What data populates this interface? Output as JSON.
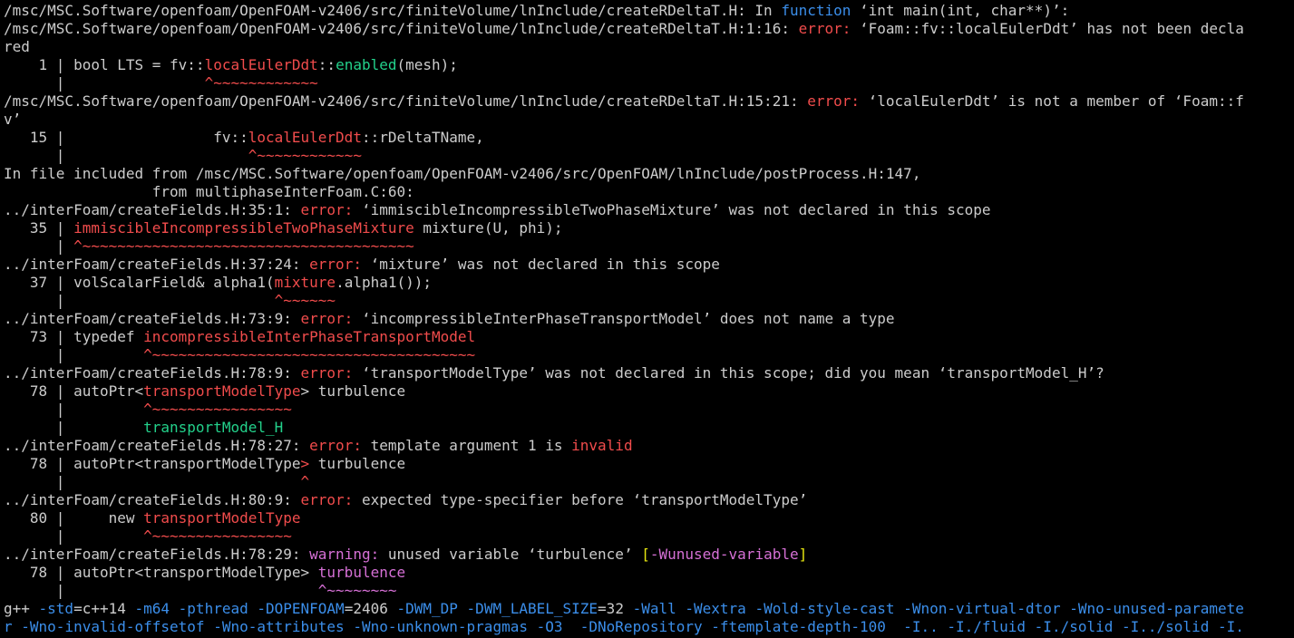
{
  "window": {
    "kind": "terminal",
    "width": 1427,
    "height": 704
  },
  "colors": {
    "background": "#000000",
    "default_text": "#cccccc",
    "error_label": "#f14c4c",
    "code_highlight": "#f14c4c",
    "keyword": "#3b8eea",
    "fixit_green": "#23d18b",
    "warning_label": "#d670d6",
    "warning_flag": "#e5e510",
    "compile_flag": "#3b8eea"
  },
  "lines": [
    {
      "segments": [
        {
          "text": "/msc/MSC.Software/openfoam/OpenFOAM-v2406/src/finiteVolume/lnInclude/createRDeltaT.H: In "
        },
        {
          "text": "function",
          "color": "#3b8eea"
        },
        {
          "text": " ‘int main(int, char**)’:"
        }
      ]
    },
    {
      "segments": [
        {
          "text": "/msc/MSC.Software/openfoam/OpenFOAM-v2406/src/finiteVolume/lnInclude/createRDeltaT.H:1:16: "
        },
        {
          "text": "error:",
          "color": "#f14c4c"
        },
        {
          "text": " ‘Foam::fv::localEulerDdt’ has not been decla"
        }
      ]
    },
    {
      "segments": [
        {
          "text": "red"
        }
      ]
    },
    {
      "segments": [
        {
          "text": "    1 | bool LTS = fv::"
        },
        {
          "text": "localEulerDdt",
          "color": "#f14c4c"
        },
        {
          "text": "::"
        },
        {
          "text": "enabled",
          "color": "#23d18b"
        },
        {
          "text": "(mesh);"
        }
      ]
    },
    {
      "segments": [
        {
          "text": "      |                ",
          "color": "#cccccc"
        },
        {
          "text": "^~~~~~~~~~~~~",
          "color": "#f14c4c"
        }
      ]
    },
    {
      "segments": [
        {
          "text": "/msc/MSC.Software/openfoam/OpenFOAM-v2406/src/finiteVolume/lnInclude/createRDeltaT.H:15:21: "
        },
        {
          "text": "error:",
          "color": "#f14c4c"
        },
        {
          "text": " ‘localEulerDdt’ is not a member of ‘Foam::f"
        }
      ]
    },
    {
      "segments": [
        {
          "text": "v’"
        }
      ]
    },
    {
      "segments": [
        {
          "text": "   15 |                 fv::"
        },
        {
          "text": "localEulerDdt",
          "color": "#f14c4c"
        },
        {
          "text": "::rDeltaTName,"
        }
      ]
    },
    {
      "segments": [
        {
          "text": "      |                     "
        },
        {
          "text": "^~~~~~~~~~~~~",
          "color": "#f14c4c"
        }
      ]
    },
    {
      "segments": [
        {
          "text": "In file included from /msc/MSC.Software/openfoam/OpenFOAM-v2406/src/OpenFOAM/lnInclude/postProcess.H:147,"
        }
      ]
    },
    {
      "segments": [
        {
          "text": "                 from multiphaseInterFoam.C:60:"
        }
      ]
    },
    {
      "segments": [
        {
          "text": "../interFoam/createFields.H:35:1: "
        },
        {
          "text": "error:",
          "color": "#f14c4c"
        },
        {
          "text": " ‘immiscibleIncompressibleTwoPhaseMixture’ was not declared in this scope"
        }
      ]
    },
    {
      "segments": [
        {
          "text": "   35 | "
        },
        {
          "text": "immiscibleIncompressibleTwoPhaseMixture",
          "color": "#f14c4c"
        },
        {
          "text": " mixture(U, phi);"
        }
      ]
    },
    {
      "segments": [
        {
          "text": "      | "
        },
        {
          "text": "^~~~~~~~~~~~~~~~~~~~~~~~~~~~~~~~~~~~~~~",
          "color": "#f14c4c"
        }
      ]
    },
    {
      "segments": [
        {
          "text": "../interFoam/createFields.H:37:24: "
        },
        {
          "text": "error:",
          "color": "#f14c4c"
        },
        {
          "text": " ‘mixture’ was not declared in this scope"
        }
      ]
    },
    {
      "segments": [
        {
          "text": "   37 | volScalarField& alpha1("
        },
        {
          "text": "mixture",
          "color": "#f14c4c"
        },
        {
          "text": ".alpha1());"
        }
      ]
    },
    {
      "segments": [
        {
          "text": "      |                        "
        },
        {
          "text": "^~~~~~~",
          "color": "#f14c4c"
        }
      ]
    },
    {
      "segments": [
        {
          "text": "../interFoam/createFields.H:73:9: "
        },
        {
          "text": "error:",
          "color": "#f14c4c"
        },
        {
          "text": " ‘incompressibleInterPhaseTransportModel’ does not name a type"
        }
      ]
    },
    {
      "segments": [
        {
          "text": "   73 | typedef "
        },
        {
          "text": "incompressibleInterPhaseTransportModel",
          "color": "#f14c4c"
        }
      ]
    },
    {
      "segments": [
        {
          "text": "      |         "
        },
        {
          "text": "^~~~~~~~~~~~~~~~~~~~~~~~~~~~~~~~~~~~~~",
          "color": "#f14c4c"
        }
      ]
    },
    {
      "segments": [
        {
          "text": "../interFoam/createFields.H:78:9: "
        },
        {
          "text": "error:",
          "color": "#f14c4c"
        },
        {
          "text": " ‘transportModelType’ was not declared in this scope; did you mean ‘transportModel_H’?"
        }
      ]
    },
    {
      "segments": [
        {
          "text": "   78 | autoPtr<"
        },
        {
          "text": "transportModelType",
          "color": "#f14c4c"
        },
        {
          "text": "> turbulence"
        }
      ]
    },
    {
      "segments": [
        {
          "text": "      |         "
        },
        {
          "text": "^~~~~~~~~~~~~~~~~",
          "color": "#f14c4c"
        }
      ]
    },
    {
      "segments": [
        {
          "text": "      |         "
        },
        {
          "text": "transportModel_H",
          "color": "#23d18b"
        }
      ]
    },
    {
      "segments": [
        {
          "text": "../interFoam/createFields.H:78:27: "
        },
        {
          "text": "error:",
          "color": "#f14c4c"
        },
        {
          "text": " template argument 1 is "
        },
        {
          "text": "invalid",
          "color": "#f14c4c"
        }
      ]
    },
    {
      "segments": [
        {
          "text": "   78 | autoPtr<transportModelType"
        },
        {
          "text": ">",
          "color": "#f14c4c"
        },
        {
          "text": " turbulence"
        }
      ]
    },
    {
      "segments": [
        {
          "text": "      |                           "
        },
        {
          "text": "^",
          "color": "#f14c4c"
        }
      ]
    },
    {
      "segments": [
        {
          "text": "../interFoam/createFields.H:80:9: "
        },
        {
          "text": "error:",
          "color": "#f14c4c"
        },
        {
          "text": " expected type-specifier before ‘transportModelType’"
        }
      ]
    },
    {
      "segments": [
        {
          "text": "   80 |     new "
        },
        {
          "text": "transportModelType",
          "color": "#f14c4c"
        }
      ]
    },
    {
      "segments": [
        {
          "text": "      |         "
        },
        {
          "text": "^~~~~~~~~~~~~~~~~",
          "color": "#f14c4c"
        }
      ]
    },
    {
      "segments": [
        {
          "text": "../interFoam/createFields.H:78:29: "
        },
        {
          "text": "warning:",
          "color": "#d670d6"
        },
        {
          "text": " unused variable ‘turbulence’ "
        },
        {
          "text": "[",
          "color": "#e5e510"
        },
        {
          "text": "-Wunused-variable",
          "color": "#d670d6"
        },
        {
          "text": "]",
          "color": "#e5e510"
        }
      ]
    },
    {
      "segments": [
        {
          "text": "   78 | autoPtr<transportModelType> "
        },
        {
          "text": "turbulence",
          "color": "#d670d6"
        }
      ]
    },
    {
      "segments": [
        {
          "text": "      |                             "
        },
        {
          "text": "^~~~~~~~~",
          "color": "#d670d6"
        }
      ]
    },
    {
      "segments": [
        {
          "text": "g++ "
        },
        {
          "text": "-std",
          "color": "#3b8eea"
        },
        {
          "text": "=c++14 "
        },
        {
          "text": "-m64 -pthread -DOPENFOAM",
          "color": "#3b8eea"
        },
        {
          "text": "=2406 "
        },
        {
          "text": "-DWM_DP -DWM_LABEL_SIZE",
          "color": "#3b8eea"
        },
        {
          "text": "=32 "
        },
        {
          "text": "-Wall -Wextra -Wold-style-cast -Wnon-virtual-dtor -Wno-unused-paramete",
          "color": "#3b8eea"
        }
      ]
    },
    {
      "segments": [
        {
          "text": "r -Wno-invalid-offsetof -Wno-attributes -Wno-unknown-pragmas -O3  -DNoRepository -ftemplate-depth-100  -I.. -I./fluid -I./solid -I../solid -I.",
          "color": "#3b8eea"
        }
      ]
    }
  ]
}
